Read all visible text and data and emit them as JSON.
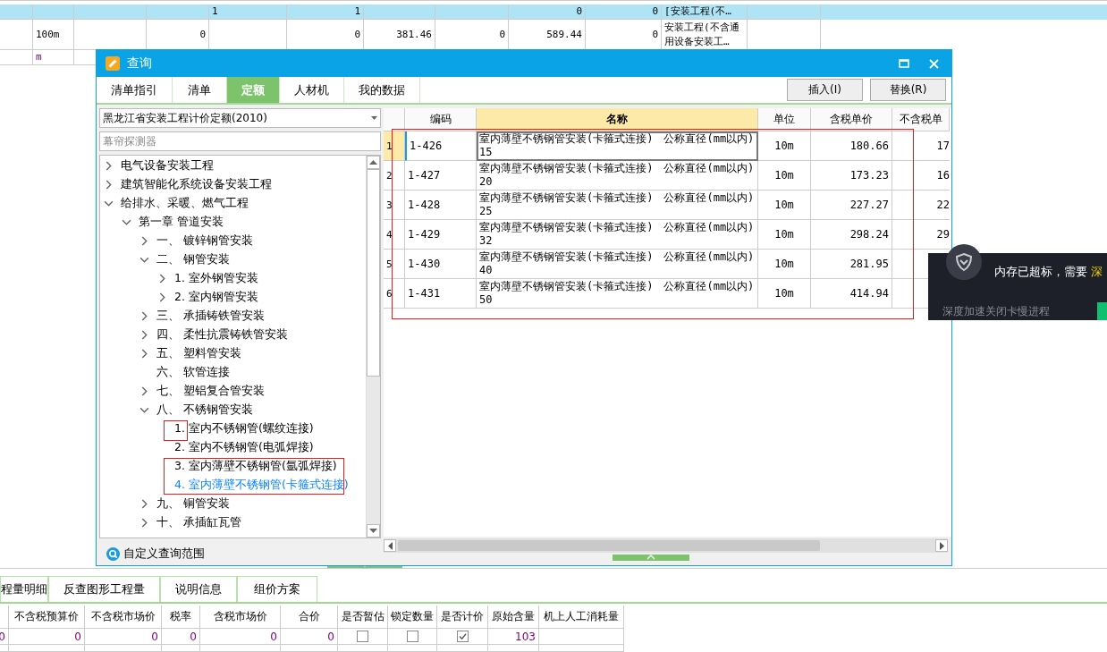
{
  "sheet": {
    "rows": [
      {
        "selected": true,
        "cells": [
          "",
          "",
          "",
          "",
          "1",
          "1",
          "",
          "",
          "0",
          "0",
          "[安装工程(不…",
          ""
        ]
      },
      {
        "selected": false,
        "cells": [
          "",
          "100m",
          "",
          "0",
          "",
          "0",
          "381.46",
          "0",
          "589.44",
          "0",
          "安装工程(不含通用设备安装工…",
          ""
        ]
      },
      {
        "selected": false,
        "cells": [
          "",
          "m",
          ""
        ]
      }
    ]
  },
  "bottom_tabs": [
    {
      "label": "程量明细",
      "selected": false
    },
    {
      "label": "反查图形工程量",
      "selected": false
    },
    {
      "label": "说明信息",
      "selected": false
    },
    {
      "label": "组价方案",
      "selected": false
    }
  ],
  "bottom_table": {
    "columns": [
      "",
      "不含税预算价",
      "不含税市场价",
      "税率",
      "含税市场价",
      "合价",
      "是否暂估",
      "锁定数量",
      "是否计价",
      "原始含量",
      "机上人工消耗量"
    ],
    "rows": [
      {
        "cells": [
          {
            "kind": "text",
            "text": "0"
          },
          {
            "kind": "text",
            "text": "0"
          },
          {
            "kind": "text",
            "text": "0"
          },
          {
            "kind": "text",
            "text": "0"
          },
          {
            "kind": "text",
            "text": "0"
          },
          {
            "kind": "text",
            "text": "0"
          },
          {
            "kind": "checkbox",
            "checked": false
          },
          {
            "kind": "checkbox",
            "checked": false
          },
          {
            "kind": "checkbox",
            "checked": true
          },
          {
            "kind": "text",
            "text": "103"
          },
          {
            "kind": "text",
            "text": ""
          }
        ]
      }
    ]
  },
  "dialog": {
    "title": "查询",
    "tabs": [
      {
        "label": "清单指引",
        "selected": false
      },
      {
        "label": "清单",
        "selected": false
      },
      {
        "label": "定额",
        "selected": true
      },
      {
        "label": "人材机",
        "selected": false
      },
      {
        "label": "我的数据",
        "selected": false
      }
    ],
    "buttons": [
      "插入(I)",
      "替换(R)"
    ],
    "library": "黑龙江省安装工程计价定额(2010)",
    "search": {
      "placeholder": "幕帘探测器"
    },
    "tree": [
      {
        "label": "电气设备安装工程",
        "expanded": false,
        "selected": false
      },
      {
        "label": "建筑智能化系统设备安装工程",
        "expanded": false,
        "selected": false
      },
      {
        "label": "给排水、采暖、燃气工程",
        "expanded": true,
        "selected": false,
        "children": [
          {
            "label": "第一章 管道安装",
            "expanded": true,
            "selected": false,
            "children": [
              {
                "label": "一、 镀锌钢管安装",
                "expanded": false,
                "selected": false
              },
              {
                "label": "二、 钢管安装",
                "expanded": true,
                "selected": false,
                "children": [
                  {
                    "label": "1. 室外钢管安装",
                    "expanded": false,
                    "selected": false
                  },
                  {
                    "label": "2. 室内钢管安装",
                    "expanded": false,
                    "selected": false
                  }
                ]
              },
              {
                "label": "三、 承插铸铁管安装",
                "expanded": false,
                "selected": false
              },
              {
                "label": "四、 柔性抗震铸铁管安装",
                "expanded": false,
                "selected": false
              },
              {
                "label": "五、 塑料管安装",
                "expanded": false,
                "selected": false
              },
              {
                "label": "六、 软管连接",
                "selected": false
              },
              {
                "label": "七、 塑铝复合管安装",
                "expanded": false,
                "selected": false
              },
              {
                "label": "八、 不锈钢管安装",
                "expanded": true,
                "selected": false,
                "children": [
                  {
                    "label": "1. 室内不锈钢管(螺纹连接)",
                    "selected": false
                  },
                  {
                    "label": "2. 室内不锈钢管(电弧焊接)",
                    "selected": false
                  },
                  {
                    "label": "3. 室内薄壁不锈钢管(氩弧焊接)",
                    "selected": false
                  },
                  {
                    "label": "4. 室内薄壁不锈钢管(卡箍式连接)",
                    "selected": true
                  }
                ]
              },
              {
                "label": "九、 铜管安装",
                "expanded": false,
                "selected": false
              },
              {
                "label": "十、 承插缸瓦管",
                "expanded": false,
                "selected": false
              }
            ]
          }
        ]
      }
    ],
    "footer_link": "自定义查询范围",
    "grid": {
      "columns": [
        "",
        "编码",
        "名称",
        "单位",
        "含税单价",
        "不含税单"
      ],
      "rows": [
        {
          "index": "1",
          "code": "1-426",
          "name": "室内薄壁不锈钢管安装(卡箍式连接)　公称直径(mm以内)\n15",
          "unit": "10m",
          "price": "180.66",
          "price_ex": "17",
          "selected": true
        },
        {
          "index": "2",
          "code": "1-427",
          "name": "室内薄壁不锈钢管安装(卡箍式连接)　公称直径(mm以内)\n20",
          "unit": "10m",
          "price": "173.23",
          "price_ex": "16",
          "selected": false
        },
        {
          "index": "3",
          "code": "1-428",
          "name": "室内薄壁不锈钢管安装(卡箍式连接)　公称直径(mm以内)\n25",
          "unit": "10m",
          "price": "227.27",
          "price_ex": "22",
          "selected": false
        },
        {
          "index": "4",
          "code": "1-429",
          "name": "室内薄壁不锈钢管安装(卡箍式连接)　公称直径(mm以内)\n32",
          "unit": "10m",
          "price": "298.24",
          "price_ex": "29",
          "selected": false
        },
        {
          "index": "5",
          "code": "1-430",
          "name": "室内薄壁不锈钢管安装(卡箍式连接)　公称直径(mm以内)\n40",
          "unit": "10m",
          "price": "281.95",
          "price_ex": "",
          "selected": false
        },
        {
          "index": "6",
          "code": "1-431",
          "name": "室内薄壁不锈钢管安装(卡箍式连接)　公称直径(mm以内)\n50",
          "unit": "10m",
          "price": "414.94",
          "price_ex": "",
          "selected": false
        }
      ]
    }
  },
  "notification": {
    "message": "内存已超标，需要",
    "action": "深",
    "hint": "深度加速关闭卡慢进程"
  }
}
